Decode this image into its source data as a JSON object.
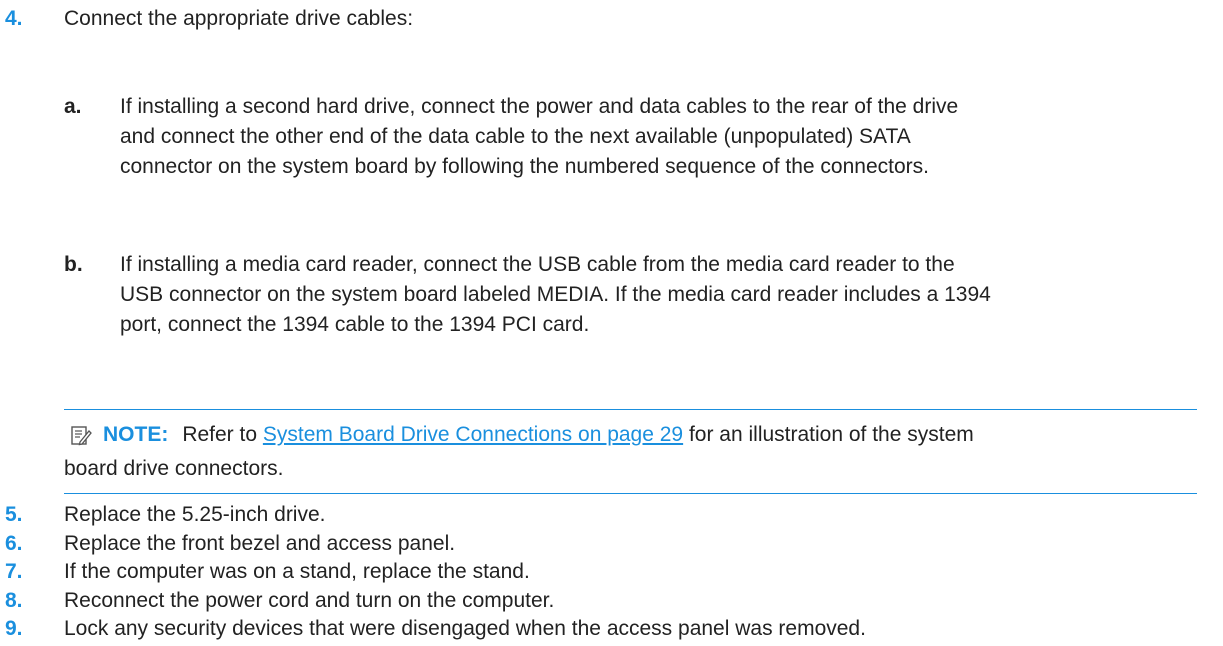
{
  "step4": {
    "number": "4.",
    "text": "Connect the appropriate drive cables:",
    "sub_a": {
      "letter": "a.",
      "lines": [
        "If installing a second hard drive, connect the power and data cables to the rear of the drive",
        "and connect the other end of the data cable to the next available (unpopulated) SATA",
        "connector on the system board by following the numbered sequence of the connectors."
      ]
    },
    "sub_b": {
      "letter": "b.",
      "lines": [
        "If installing a media card reader, connect the USB cable from the media card reader to the",
        "USB connector on the system board labeled MEDIA. If the media card reader includes a 1394",
        "port, connect the 1394 cable to the 1394 PCI card."
      ]
    },
    "note": {
      "icon": "note-icon",
      "label": "NOTE:",
      "prefix": "Refer to ",
      "link": "System Board Drive Connections on page 29",
      "suffix": " for an illustration of the system",
      "line2": "board drive connectors."
    }
  },
  "steps": [
    {
      "number": "5.",
      "text": "Replace the 5.25-inch drive."
    },
    {
      "number": "6.",
      "text": "Replace the front bezel and access panel."
    },
    {
      "number": "7.",
      "text": "If the computer was on a stand, replace the stand."
    },
    {
      "number": "8.",
      "text": "Reconnect the power cord and turn on the computer."
    },
    {
      "number": "9.",
      "text": "Lock any security devices that were disengaged when the access panel was removed."
    }
  ],
  "colors": {
    "accent": "#1a8fde",
    "text": "#222222"
  }
}
